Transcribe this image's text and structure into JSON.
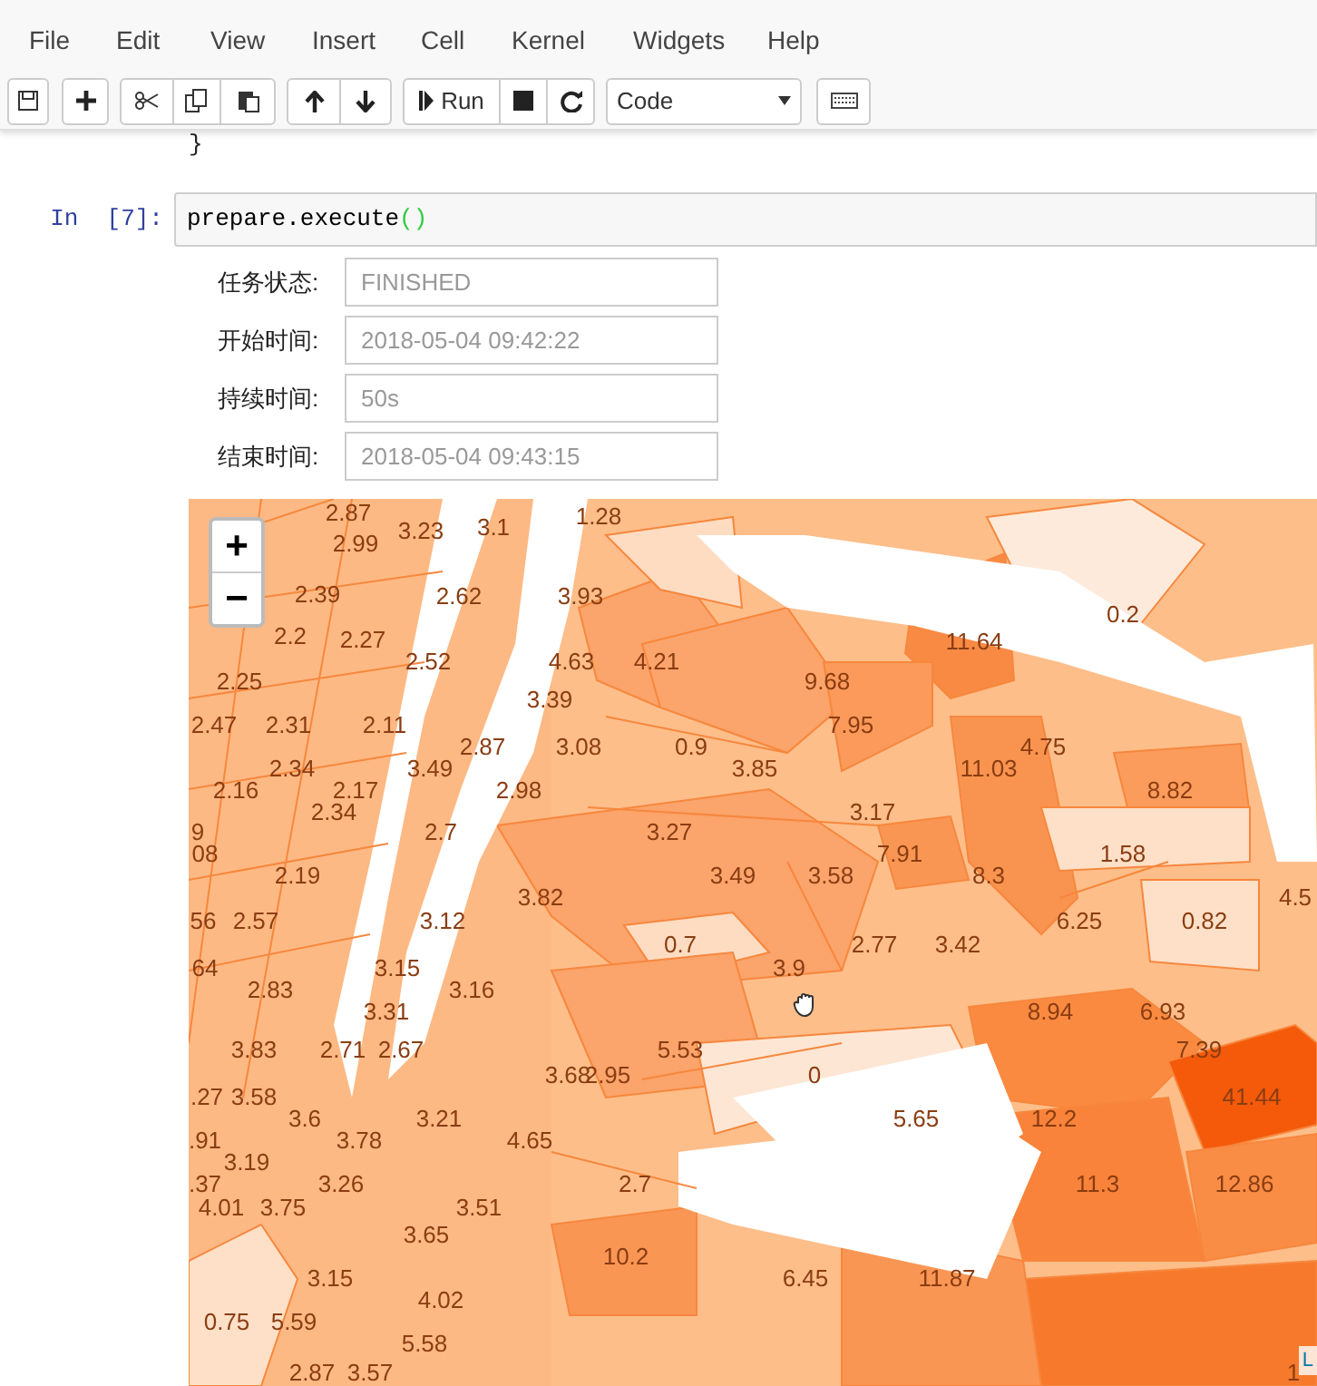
{
  "menu": [
    "File",
    "Edit",
    "View",
    "Insert",
    "Cell",
    "Kernel",
    "Widgets",
    "Help"
  ],
  "toolbar": {
    "run_label": "Run",
    "cell_type": "Code"
  },
  "previous_output": "}",
  "cell": {
    "prompt": "In  [7]:",
    "code_name": "prepare.execute",
    "code_parens": "()"
  },
  "fields": [
    {
      "label": "任务状态:",
      "value": "FINISHED"
    },
    {
      "label": "开始时间:",
      "value": "2018-05-04 09:42:22"
    },
    {
      "label": "持续时间:",
      "value": "50s"
    },
    {
      "label": "结束时间:",
      "value": "2018-05-04 09:43:15"
    }
  ],
  "map": {
    "zoom_in": "+",
    "zoom_out": "−",
    "attribution": "L",
    "labels": [
      "2.87",
      "1.28",
      "3.23",
      "3.1",
      "2.99",
      "2.39",
      "2.62",
      "3.93",
      "0.2",
      "2.2",
      "2.27",
      "11.64",
      "2.52",
      "4.63",
      "4.21",
      "2.25",
      "9.68",
      "3.39",
      "2.47",
      "2.31",
      "2.11",
      "7.95",
      "2.87",
      "3.08",
      "0.9",
      "4.75",
      "2.34",
      "3.49",
      "3.85",
      "11.03",
      "2.16",
      "2.17",
      "2.98",
      "8.82",
      "2.34",
      "3.17",
      "9",
      "2.7",
      "3.27",
      "08",
      "7.91",
      "1.58",
      "2.19",
      "3.49",
      "3.58",
      "8.3",
      "3.82",
      "4.5",
      "56",
      "2.57",
      "3.12",
      "6.25",
      "0.82",
      "0.7",
      "2.77",
      "3.42",
      "64",
      "3.15",
      "3.9",
      "2.83",
      "3.16",
      "3.31",
      "8.94",
      "6.93",
      "3.83",
      "2.71",
      "2.67",
      "5.53",
      "7.39",
      "3.68",
      "2.95",
      "0",
      ".27",
      "3.58",
      "41.44",
      "3.6",
      "3.21",
      "5.65",
      "12.2",
      ".91",
      "3.78",
      "4.65",
      "3.19",
      ".37",
      "3.26",
      "2.7",
      "11.3",
      "12.86",
      "4.01",
      "3.75",
      "3.51",
      "3.65",
      "10.2",
      "3.15",
      "6.45",
      "11.87",
      "4.02",
      "0.75",
      "5.59",
      "5.58",
      "2.87",
      "3.57",
      "1"
    ]
  }
}
